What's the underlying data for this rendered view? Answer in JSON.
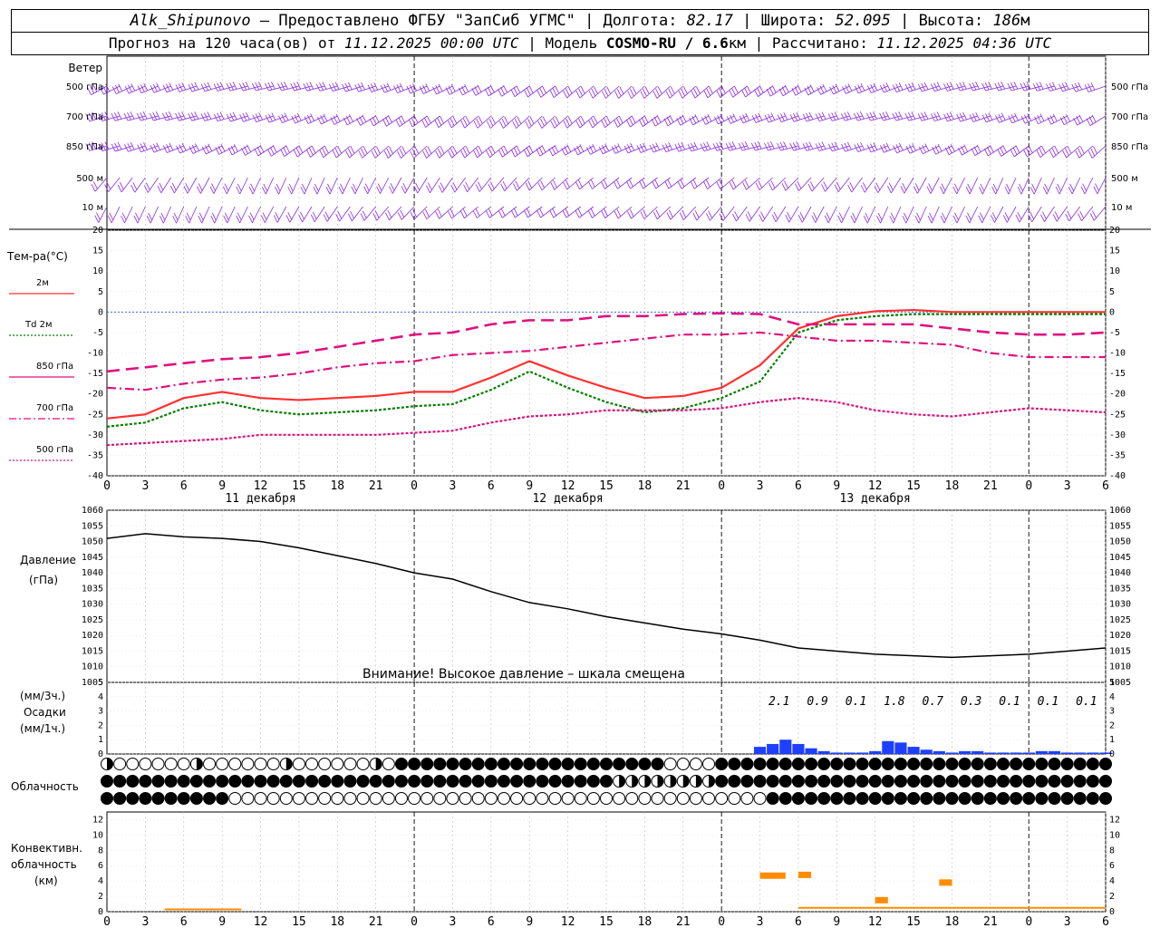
{
  "header": {
    "station": "Alk_Shipunovo",
    "provider": " – Предоставлено ФГБУ \"ЗапСиб УГМС\" | Долгота: ",
    "lon": "82.17",
    "lat_label": " | Широта: ",
    "lat": "52.095",
    "alt_label": " | Высота: ",
    "alt": "186",
    "alt_unit": "м",
    "forecast_label": "Прогноз на 120 часа(ов) от ",
    "forecast_time": "11.12.2025 00:00 UTC",
    "model_label": " | Модель ",
    "model": "COSMO-RU / 6.6",
    "model_unit": "км",
    "calc_label": " | Рассчитано: ",
    "calc_time": "11.12.2025 04:36 UTC"
  },
  "colors": {
    "wind": "#8a2be2",
    "t2m": "#ff3030",
    "td": "#008000",
    "t850": "#e0107f",
    "pressure": "#000000",
    "precip": "#1f3fff",
    "convective": "#ff8c00",
    "zero_line": "#1e50ff"
  },
  "wind_panel": {
    "title": "Ветер",
    "levels": [
      "500 гПа",
      "700 гПа",
      "850 гПа",
      "500 м",
      "10  м"
    ]
  },
  "temp_panel": {
    "title": "Тем-ра(°C)",
    "legend": [
      {
        "label": "2м",
        "color": "#ff3030",
        "dash": "solid"
      },
      {
        "label": "Td  2м",
        "color": "#008000",
        "dash": "dotted"
      },
      {
        "label": "850 гПа",
        "color": "#e0107f",
        "dash": "solid"
      },
      {
        "label": "700 гПа",
        "color": "#e0107f",
        "dash": "dashdot"
      },
      {
        "label": "500 гПа",
        "color": "#e0107f",
        "dash": "dotted"
      }
    ]
  },
  "pressure_panel": {
    "title": "Давление",
    "unit": "(гПа)",
    "warning": "Внимание! Высокое давление – шкала смещена"
  },
  "precip_panel": {
    "unit3": "(мм/3ч.)",
    "title": "Осадки",
    "unit1": "(мм/1ч.)",
    "totals": [
      "2.1",
      "0.9",
      "0.1",
      "1.8",
      "0.7",
      "0.3",
      "0.1",
      "0.1",
      "0.1"
    ]
  },
  "cloud_panel": {
    "title": "Облачность"
  },
  "conv_panel": {
    "title1": "Конвективн.",
    "title2": "облачность",
    "title3": "(км)"
  },
  "x_axis": {
    "hour_labels": [
      "0",
      "3",
      "6",
      "9",
      "12",
      "15",
      "18",
      "21",
      "0",
      "3",
      "6",
      "9",
      "12",
      "15",
      "18",
      "21",
      "0",
      "3",
      "6",
      "9",
      "12",
      "15",
      "18",
      "21",
      "0",
      "3",
      "6"
    ],
    "days": [
      "11 декабря",
      "12 декабря",
      "13 декабря"
    ]
  },
  "chart_data": [
    {
      "type": "line",
      "title": "Тем-ра(°C)",
      "ylim": [
        -40,
        20
      ],
      "x_hours": [
        0,
        3,
        6,
        9,
        12,
        15,
        18,
        21,
        24,
        27,
        30,
        33,
        36,
        39,
        42,
        45,
        48,
        51,
        54,
        57,
        60,
        63,
        66,
        69,
        72,
        75,
        78
      ],
      "series": [
        {
          "name": "2м",
          "values": [
            -26,
            -25,
            -21,
            -19.5,
            -21,
            -21.5,
            -21,
            -20.5,
            -19.5,
            -19.5,
            -16,
            -12,
            -15.5,
            -18.5,
            -21,
            -20.5,
            -18.5,
            -13,
            -4,
            -1,
            0.2,
            0.5,
            0,
            0,
            0,
            0,
            0
          ]
        },
        {
          "name": "Td  2м",
          "values": [
            -28,
            -27,
            -23.5,
            -22,
            -24,
            -25,
            -24.5,
            -24,
            -23,
            -22.5,
            -19,
            -14.5,
            -18.5,
            -22,
            -24.5,
            -23.5,
            -21,
            -17,
            -5,
            -2,
            -1,
            -0.5,
            -0.5,
            -0.5,
            -0.5,
            -0.5,
            -0.5
          ]
        },
        {
          "name": "850 гПа",
          "values": [
            -14.5,
            -13.5,
            -12.5,
            -11.5,
            -11,
            -10,
            -8.5,
            -7,
            -5.5,
            -5,
            -3,
            -2,
            -2,
            -1,
            -1,
            -0.5,
            -0.3,
            -0.5,
            -3,
            -3,
            -3,
            -3,
            -4,
            -5,
            -5.5,
            -5.5,
            -5
          ]
        },
        {
          "name": "700 гПа",
          "values": [
            -18.5,
            -19,
            -17.5,
            -16.5,
            -16,
            -15,
            -13.5,
            -12.5,
            -12,
            -10.5,
            -10,
            -9.5,
            -8.5,
            -7.5,
            -6.5,
            -5.5,
            -5.5,
            -5,
            -6,
            -7,
            -7,
            -7.5,
            -8,
            -10,
            -11,
            -11,
            -11
          ]
        },
        {
          "name": "500 гПа",
          "values": [
            -32.5,
            -32,
            -31.5,
            -31,
            -30,
            -30,
            -30,
            -30,
            -29.5,
            -29,
            -27,
            -25.5,
            -25,
            -24,
            -24,
            -24,
            -23.5,
            -22,
            -21,
            -22,
            -24,
            -25,
            -25.5,
            -24.5,
            -23.5,
            -24,
            -24.5
          ]
        }
      ]
    },
    {
      "type": "line",
      "title": "Давление",
      "ylim": [
        1005,
        1060
      ],
      "x_hours": [
        0,
        3,
        6,
        9,
        12,
        15,
        18,
        21,
        24,
        27,
        30,
        33,
        36,
        39,
        42,
        45,
        48,
        51,
        54,
        57,
        60,
        63,
        66,
        69,
        72,
        75,
        78
      ],
      "series": [
        {
          "name": "Давление",
          "values": [
            1051,
            1052.5,
            1051.5,
            1051,
            1050,
            1048,
            1045.5,
            1043,
            1040,
            1038,
            1034,
            1030.5,
            1028.5,
            1026,
            1024,
            1022,
            1020.5,
            1018.5,
            1016,
            1015,
            1014,
            1013.5,
            1013,
            1013.5,
            1014,
            1015,
            1016
          ]
        }
      ]
    },
    {
      "type": "bar",
      "title": "Осадки",
      "ylim": [
        0,
        5
      ],
      "x_hours": [
        51,
        52,
        53,
        54,
        55,
        56,
        57,
        58,
        59,
        60,
        61,
        62,
        63,
        64,
        65,
        66,
        67,
        68,
        69,
        70,
        71,
        72,
        73,
        74,
        75,
        76,
        77,
        78
      ],
      "series": [
        {
          "name": "(мм/1ч.)",
          "values": [
            0.5,
            0.7,
            1.0,
            0.7,
            0.4,
            0.2,
            0.1,
            0.1,
            0.1,
            0.2,
            0.9,
            0.8,
            0.5,
            0.3,
            0.2,
            0.1,
            0.2,
            0.2,
            0.1,
            0.1,
            0.1,
            0.1,
            0.2,
            0.2,
            0.1,
            0.1,
            0.1,
            0.1
          ]
        }
      ]
    },
    {
      "type": "bar",
      "title": "Конвективн. облачность",
      "ylim": [
        0,
        13
      ],
      "series": [
        {
          "name": "shallow",
          "x_range_hours": [
            [
              4.5,
              10.5
            ],
            [
              54,
              78
            ]
          ],
          "height_km": [
            0.3,
            0.5
          ]
        },
        {
          "name": "deep",
          "x_range_hours": [
            [
              51,
              53
            ],
            [
              54,
              55
            ],
            [
              60,
              61
            ],
            [
              65,
              66
            ]
          ],
          "height_km": [
            4.7,
            4.8,
            1.5,
            3.8
          ]
        }
      ]
    }
  ]
}
